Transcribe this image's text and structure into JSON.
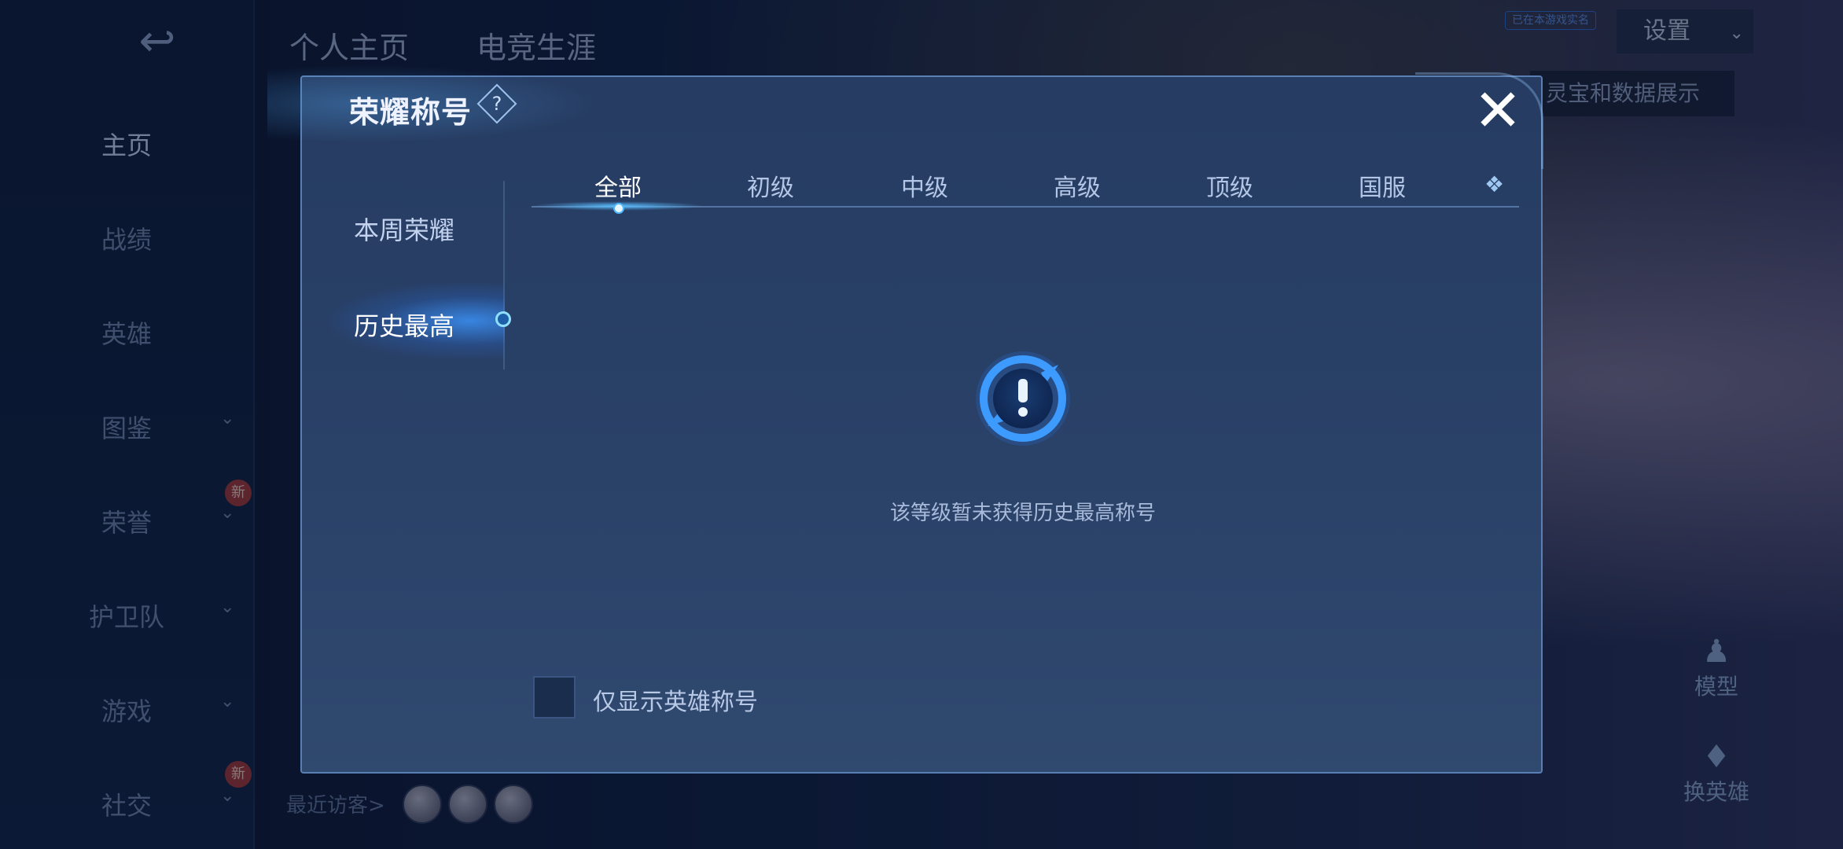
{
  "header": {
    "back_icon": "back-arrow-icon",
    "tabs": [
      {
        "label": "个人主页"
      },
      {
        "label": "电竞生涯"
      }
    ],
    "settings_label": "设置",
    "settings_tag": "已在本游戏实名"
  },
  "sidebar": {
    "items": [
      {
        "label": "主页"
      },
      {
        "label": "战绩"
      },
      {
        "label": "英雄"
      },
      {
        "label": "图鉴"
      },
      {
        "label": "荣誉",
        "badge": "新"
      },
      {
        "label": "护卫队"
      },
      {
        "label": "游戏"
      },
      {
        "label": "社交",
        "badge": "新"
      }
    ]
  },
  "footer": {
    "visitors_label": "最近访客>"
  },
  "right_panel": {
    "banner": "灵宝和数据展示",
    "model_label": "模型",
    "switch_hero_label": "换英雄"
  },
  "modal": {
    "title": "荣耀称号",
    "help_icon": "question-diamond-icon",
    "close_icon": "close-x-icon",
    "sections": [
      {
        "label": "本周荣耀"
      },
      {
        "label": "历史最高",
        "active": true
      }
    ],
    "tabs": [
      {
        "label": "全部",
        "active": true
      },
      {
        "label": "初级"
      },
      {
        "label": "中级"
      },
      {
        "label": "高级"
      },
      {
        "label": "顶级"
      },
      {
        "label": "国服"
      }
    ],
    "more_icon": "diamond-cluster-icon",
    "empty_icon": "exclamation-circle-icon",
    "empty_text": "该等级暂未获得历史最高称号",
    "checkbox_label": "仅显示英雄称号",
    "checkbox_checked": false
  },
  "colors": {
    "accent": "#4cb6ff",
    "modal_bg": "#2a4168",
    "text_primary": "#ffffff",
    "text_muted": "#a9bbda",
    "badge_red": "#a33a3a"
  }
}
